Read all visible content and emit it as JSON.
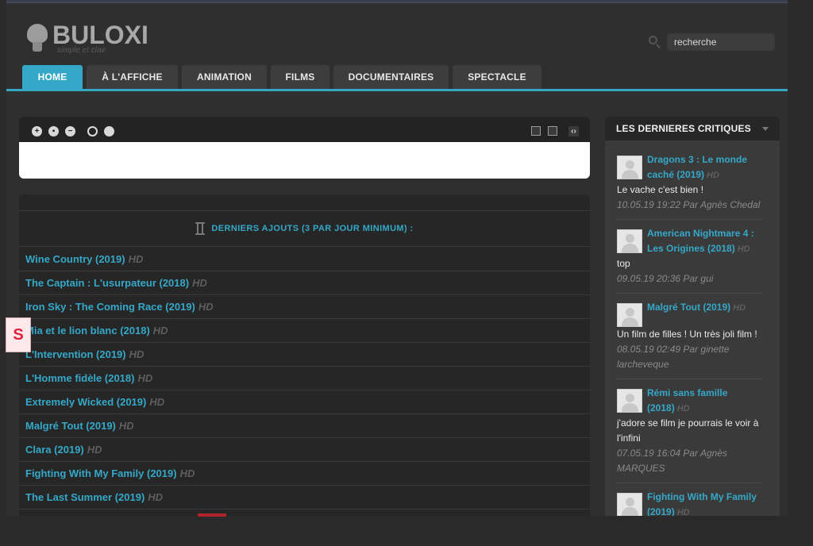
{
  "site": {
    "logo": "BULOXI",
    "tagline": "simple et clair",
    "search_placeholder": "recherche"
  },
  "nav": {
    "tabs": [
      {
        "label": "HOME",
        "active": true
      },
      {
        "label": "À L'AFFICHE",
        "active": false
      },
      {
        "label": "ANIMATION",
        "active": false
      },
      {
        "label": "FILMS",
        "active": false
      },
      {
        "label": "DOCUMENTAIRES",
        "active": false
      },
      {
        "label": "SPECTACLE",
        "active": false
      }
    ]
  },
  "list": {
    "title": "DERNIERS AJOUTS (3 PAR JOUR MINIMUM) :",
    "rows": [
      {
        "title": "Wine Country (2019)",
        "tag": "HD"
      },
      {
        "title": "The Captain : L'usurpateur (2018)",
        "tag": "HD"
      },
      {
        "title": "Iron Sky : The Coming Race (2019)",
        "tag": "HD"
      },
      {
        "title": "Mia et le lion blanc (2018)",
        "tag": "HD"
      },
      {
        "title": "L'Intervention (2019)",
        "tag": "HD"
      },
      {
        "title": "L'Homme fidèle (2018)",
        "tag": "HD"
      },
      {
        "title": "Extremely Wicked (2019)",
        "tag": "HD"
      },
      {
        "title": "Malgré Tout (2019)",
        "tag": "HD"
      },
      {
        "title": "Clara (2019)",
        "tag": "HD"
      },
      {
        "title": "Fighting With My Family (2019)",
        "tag": "HD"
      },
      {
        "title": "The Last Summer (2019)",
        "tag": "HD"
      }
    ]
  },
  "sidebar": {
    "title": "LES DERNIERES CRITIQUES",
    "reviews": [
      {
        "title": "Dragons 3 : Le monde caché (2019)",
        "tag": "HD",
        "text": "Le vache c'est bien !",
        "meta": "10.05.19 19:22 Par Agnès Chedal"
      },
      {
        "title": "American Nightmare 4 : Les Origines (2018)",
        "tag": "HD",
        "text": "top",
        "meta": "09.05.19 20:36 Par gui"
      },
      {
        "title": "Malgré Tout (2019)",
        "tag": "HD",
        "text": "Un film de filles ! Un très joli film !",
        "meta": "08.05.19 02:49 Par ginette larcheveque"
      },
      {
        "title": "Rémi sans famille (2018)",
        "tag": "HD",
        "text": "j'adore se film je pourrais le voir à l'infini",
        "meta": "07.05.19 16:04 Par Agnès MARQUES"
      },
      {
        "title": "Fighting With My Family (2019)",
        "tag": "HD",
        "text": "",
        "meta": ""
      }
    ]
  },
  "overlay": {
    "badge": "S"
  },
  "colors": {
    "accent": "#35a8c8",
    "background": "#2f2f2f"
  }
}
